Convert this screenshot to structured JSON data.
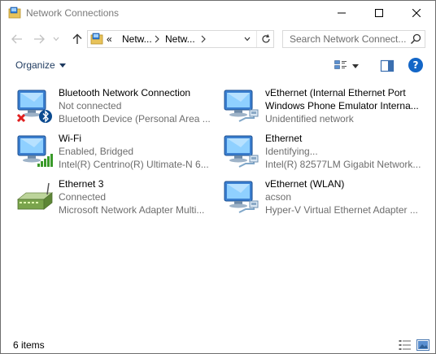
{
  "window": {
    "title": "Network Connections"
  },
  "address": {
    "overflow": "«",
    "crumbs": [
      "Netw...",
      "Netw..."
    ],
    "search_placeholder": "Search Network Connect..."
  },
  "toolbar": {
    "organize_label": "Organize",
    "help_label": "?"
  },
  "items": [
    {
      "name": "Bluetooth Network Connection",
      "line2": "Not connected",
      "line3": "Bluetooth Device (Personal Area ...",
      "icon": "bluetooth-adapter-icon"
    },
    {
      "name": "vEthernet (Internal Ethernet Port",
      "line2": "Windows Phone Emulator Interna...",
      "line3": "Unidentified network",
      "icon": "ethernet-adapter-icon"
    },
    {
      "name": "Wi-Fi",
      "line2": "Enabled, Bridged",
      "line3": "Intel(R) Centrino(R) Ultimate-N 6...",
      "icon": "wifi-adapter-icon"
    },
    {
      "name": "Ethernet",
      "line2": "Identifying...",
      "line3": "Intel(R) 82577LM Gigabit Network...",
      "icon": "ethernet-adapter-icon"
    },
    {
      "name": "Ethernet 3",
      "line2": "Connected",
      "line3": "Microsoft Network Adapter Multi...",
      "icon": "bridge-adapter-icon"
    },
    {
      "name": "vEthernet (WLAN)",
      "line2": "acson",
      "line3": "Hyper-V Virtual Ethernet Adapter ...",
      "icon": "ethernet-adapter-icon"
    }
  ],
  "status": {
    "item_count": "6 items"
  },
  "colors": {
    "accent": "#1366c7",
    "muted_text": "#6d6d6d",
    "disconnected": "#e02020",
    "signal": "#3a9a2a"
  }
}
